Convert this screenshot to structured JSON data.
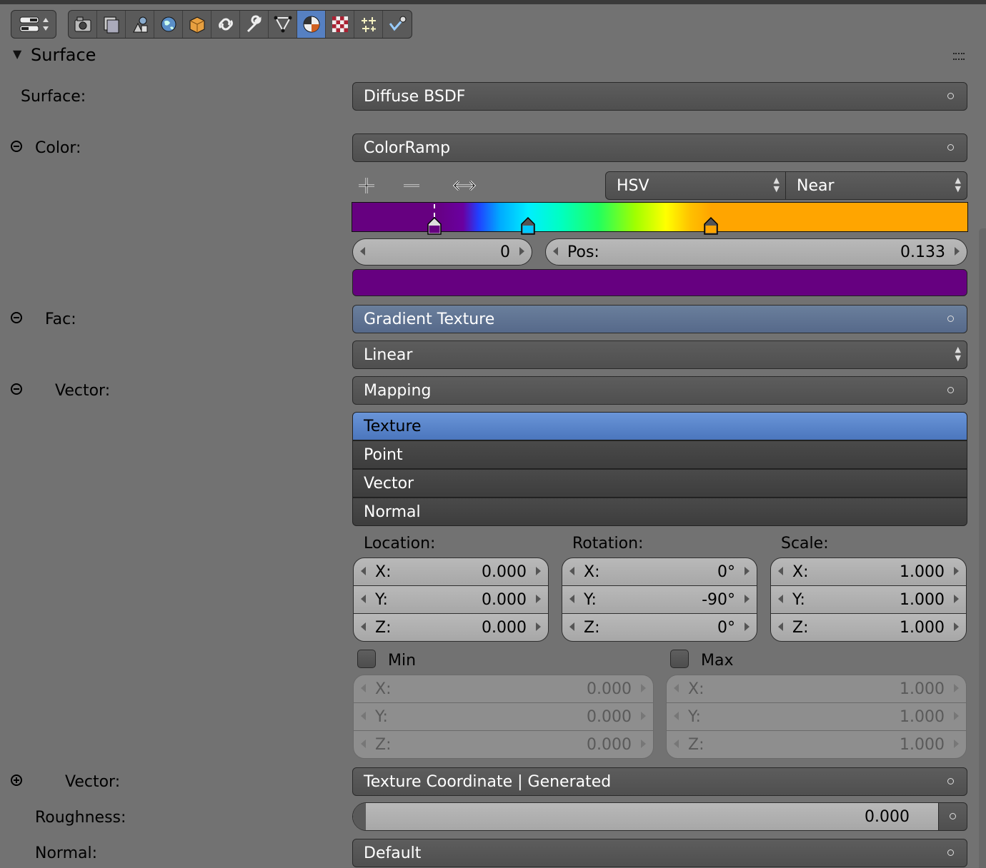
{
  "toolbar": {
    "icons": [
      "editor-type-icon",
      "render-icon",
      "render-layers-icon",
      "scene-icon",
      "world-icon",
      "object-icon",
      "constraints-icon",
      "modifier-icon",
      "object-data-icon",
      "material-icon",
      "texture-icon",
      "particles-icon",
      "physics-icon"
    ],
    "active": "material-icon"
  },
  "panel": {
    "title": "Surface"
  },
  "surface": {
    "label": "Surface:",
    "value": "Diffuse BSDF"
  },
  "color": {
    "label": "Color:",
    "value": "ColorRamp"
  },
  "ramp": {
    "mode": "HSV",
    "interpolation": "Near",
    "index": "0",
    "pos_label": "Pos:",
    "pos_value": "0.133",
    "selected_color": "#660080",
    "stops": [
      {
        "pos": 0.133,
        "color": "#660080"
      },
      {
        "pos": 0.286,
        "color": "#00c8ff"
      },
      {
        "pos": 0.583,
        "color": "#ffa500"
      }
    ]
  },
  "fac": {
    "label": "Fac:",
    "value": "Gradient Texture",
    "type": "Linear"
  },
  "vector": {
    "label": "Vector:",
    "value": "Mapping",
    "options": [
      "Texture",
      "Point",
      "Vector",
      "Normal"
    ],
    "selected": "Texture"
  },
  "mapping": {
    "location": {
      "label": "Location:",
      "x": "0.000",
      "y": "0.000",
      "z": "0.000"
    },
    "rotation": {
      "label": "Rotation:",
      "x": "0°",
      "y": "-90°",
      "z": "0°"
    },
    "scale": {
      "label": "Scale:",
      "x": "1.000",
      "y": "1.000",
      "z": "1.000"
    },
    "axis": {
      "x": "X:",
      "y": "Y:",
      "z": "Z:"
    },
    "min": {
      "label": "Min",
      "checked": false,
      "x": "0.000",
      "y": "0.000",
      "z": "0.000"
    },
    "max": {
      "label": "Max",
      "checked": false,
      "x": "1.000",
      "y": "1.000",
      "z": "1.000"
    }
  },
  "vector2": {
    "label": "Vector:",
    "value": "Texture Coordinate | Generated"
  },
  "roughness": {
    "label": "Roughness:",
    "value": "0.000"
  },
  "normal": {
    "label": "Normal:",
    "value": "Default"
  }
}
